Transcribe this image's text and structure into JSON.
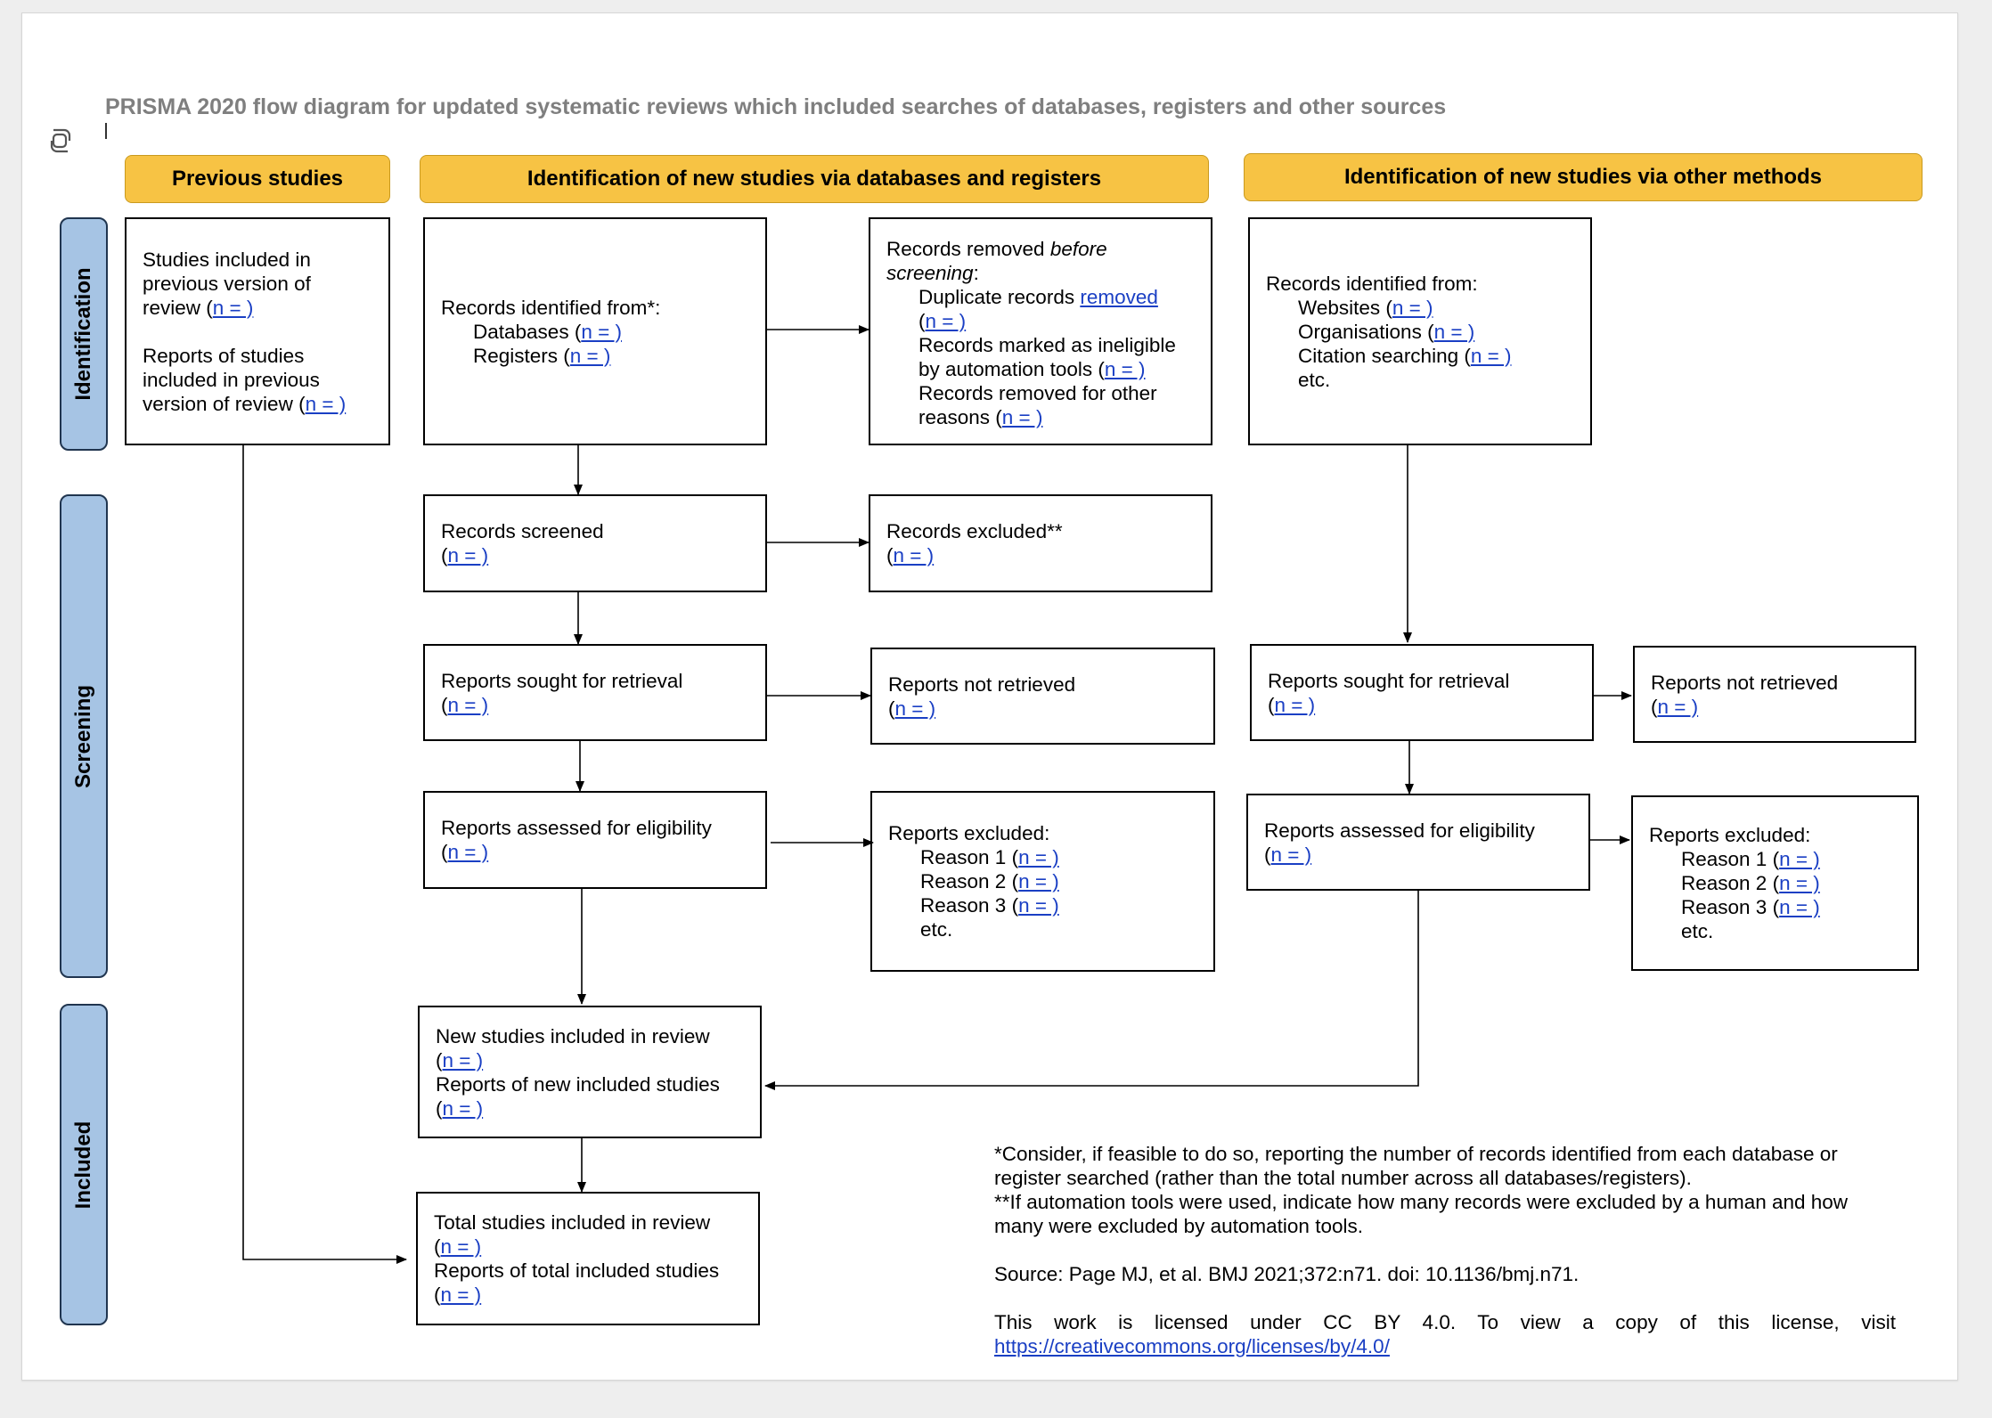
{
  "title": "PRISMA 2020 flow diagram for updated systematic reviews which included searches of databases, registers and other sources",
  "n_value": "n = )",
  "headers": {
    "previous": "Previous studies",
    "databases": "Identification of new studies via databases and registers",
    "other": "Identification of new studies via other methods"
  },
  "phases": {
    "identification": "Identification",
    "screening": "Screening",
    "included": "Included"
  },
  "boxes": {
    "previous_studies": {
      "line1": "Studies included in",
      "line2": "previous version of",
      "line3": "review (",
      "line5": "Reports of studies",
      "line6": "included in previous",
      "line7": "version of review ("
    },
    "records_identified": {
      "line1": "Records identified from*:",
      "line2": "Databases (",
      "line3": "Registers ("
    },
    "records_removed": {
      "line1a": "Records removed ",
      "line1b": "before",
      "line2a": "screening",
      "line2b": ":",
      "line3a": "Duplicate records ",
      "line3b": "removed",
      "line4": "(",
      "line5": "Records marked as ineligible",
      "line6": "by automation tools (",
      "line7": "Records removed for other",
      "line8": "reasons ("
    },
    "records_screened": {
      "line1": "Records screened",
      "line2": "("
    },
    "records_excluded": {
      "line1": "Records excluded**",
      "line2": "("
    },
    "reports_sought_db": {
      "line1": "Reports sought for retrieval",
      "line2": "("
    },
    "reports_not_retrieved_db": {
      "line1": "Reports not retrieved",
      "line2": "("
    },
    "reports_assessed_db": {
      "line1": "Reports assessed for eligibility",
      "line2": "("
    },
    "reports_excluded_db": {
      "line1": "Reports excluded:",
      "line2": "Reason 1 (",
      "line3": "Reason 2 (",
      "line4": "Reason 3 (",
      "line5": "etc."
    },
    "other_identified": {
      "line1": "Records identified from:",
      "line2": "Websites (",
      "line3": "Organisations (",
      "line4": "Citation searching (",
      "line5": "etc."
    },
    "reports_sought_other": {
      "line1": "Reports sought for retrieval",
      "line2": "("
    },
    "reports_not_retrieved_other": {
      "line1": "Reports not retrieved",
      "line2": "("
    },
    "reports_assessed_other": {
      "line1": "Reports assessed for eligibility",
      "line2": "("
    },
    "reports_excluded_other": {
      "line1": "Reports excluded:",
      "line2": "Reason 1 (",
      "line3": "Reason 2 (",
      "line4": "Reason 3 (",
      "line5": "etc."
    },
    "new_included": {
      "line1": "New studies included in review",
      "line2": "(",
      "line3": "Reports of new included studies",
      "line4": "("
    },
    "total_included": {
      "line1": "Total studies included in review",
      "line2": "(",
      "line3": "Reports of total included studies",
      "line4": "("
    }
  },
  "notes": {
    "note1": "*Consider, if feasible to do so, reporting the number of records identified from each database or register searched (rather than the total number across all databases/registers).",
    "note2": "**If automation tools were used, indicate how many records were excluded by a human and how many were excluded by automation tools.",
    "source": "Source: Page MJ, et al. BMJ 2021;372:n71. doi: 10.1136/bmj.n71.",
    "license": "This work is licensed under CC BY 4.0. To view a copy of this license, visit",
    "license_url": "https://creativecommons.org/licenses/by/4.0/"
  }
}
